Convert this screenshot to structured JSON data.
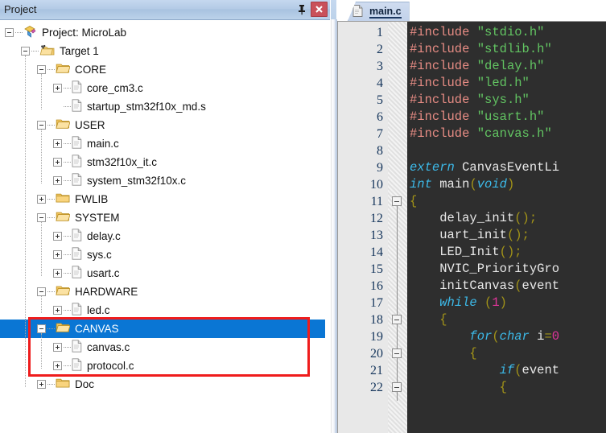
{
  "project_panel": {
    "title": "Project",
    "pin_icon": "pin-icon",
    "close_icon": "close-icon",
    "tree": [
      {
        "label": "Project: MicroLab",
        "depth": 0,
        "icon": "project-icon",
        "expander": "minus",
        "selected": false
      },
      {
        "label": "Target 1",
        "depth": 1,
        "icon": "target-folder-icon",
        "expander": "minus",
        "selected": false
      },
      {
        "label": "CORE",
        "depth": 2,
        "icon": "folder-open-icon",
        "expander": "minus",
        "selected": false
      },
      {
        "label": "core_cm3.c",
        "depth": 3,
        "icon": "c-file-icon",
        "expander": "plus",
        "selected": false
      },
      {
        "label": "startup_stm32f10x_md.s",
        "depth": 3,
        "icon": "s-file-icon",
        "expander": "none",
        "selected": false
      },
      {
        "label": "USER",
        "depth": 2,
        "icon": "folder-open-icon",
        "expander": "minus",
        "selected": false
      },
      {
        "label": "main.c",
        "depth": 3,
        "icon": "c-file-icon",
        "expander": "plus",
        "selected": false
      },
      {
        "label": "stm32f10x_it.c",
        "depth": 3,
        "icon": "c-file-icon",
        "expander": "plus",
        "selected": false
      },
      {
        "label": "system_stm32f10x.c",
        "depth": 3,
        "icon": "c-file-icon",
        "expander": "plus",
        "selected": false
      },
      {
        "label": "FWLIB",
        "depth": 2,
        "icon": "folder-closed-icon",
        "expander": "plus",
        "selected": false
      },
      {
        "label": "SYSTEM",
        "depth": 2,
        "icon": "folder-open-icon",
        "expander": "minus",
        "selected": false
      },
      {
        "label": "delay.c",
        "depth": 3,
        "icon": "c-file-icon",
        "expander": "plus",
        "selected": false
      },
      {
        "label": "sys.c",
        "depth": 3,
        "icon": "c-file-icon",
        "expander": "plus",
        "selected": false
      },
      {
        "label": "usart.c",
        "depth": 3,
        "icon": "c-file-icon",
        "expander": "plus",
        "selected": false
      },
      {
        "label": "HARDWARE",
        "depth": 2,
        "icon": "folder-open-icon",
        "expander": "minus",
        "selected": false
      },
      {
        "label": "led.c",
        "depth": 3,
        "icon": "c-file-icon",
        "expander": "plus",
        "selected": false
      },
      {
        "label": "CANVAS",
        "depth": 2,
        "icon": "folder-open-icon",
        "expander": "minus",
        "selected": true
      },
      {
        "label": "canvas.c",
        "depth": 3,
        "icon": "c-file-icon",
        "expander": "plus",
        "selected": false
      },
      {
        "label": "protocol.c",
        "depth": 3,
        "icon": "c-file-icon",
        "expander": "plus",
        "selected": false
      },
      {
        "label": "Doc",
        "depth": 2,
        "icon": "folder-closed-icon",
        "expander": "plus",
        "selected": false
      }
    ]
  },
  "annotation": {
    "shape": "rectangle",
    "color": "#ef1c1c",
    "covers": [
      "CANVAS",
      "canvas.c",
      "protocol.c"
    ]
  },
  "editor": {
    "tabs": [
      {
        "label": "main.c",
        "icon": "c-file-icon",
        "active": true
      }
    ],
    "selection_color": "#0a76d4",
    "background": "#2e2e2e",
    "gutter_background": "#e8e8e8",
    "line_number_color": "#16365c",
    "first_visible_line": 1,
    "last_visible_line": 22,
    "lines": [
      {
        "n": 1,
        "fold": false,
        "text": "#include \"stdio.h\""
      },
      {
        "n": 2,
        "fold": false,
        "text": "#include \"stdlib.h\""
      },
      {
        "n": 3,
        "fold": false,
        "text": "#include \"delay.h\""
      },
      {
        "n": 4,
        "fold": false,
        "text": "#include \"led.h\""
      },
      {
        "n": 5,
        "fold": false,
        "text": "#include \"sys.h\""
      },
      {
        "n": 6,
        "fold": false,
        "text": "#include \"usart.h\""
      },
      {
        "n": 7,
        "fold": false,
        "text": "#include \"canvas.h\""
      },
      {
        "n": 8,
        "fold": false,
        "text": ""
      },
      {
        "n": 9,
        "fold": false,
        "text": "extern CanvasEventLi"
      },
      {
        "n": 10,
        "fold": false,
        "text": "int main(void)"
      },
      {
        "n": 11,
        "fold": true,
        "text": "{"
      },
      {
        "n": 12,
        "fold": false,
        "text": "    delay_init();"
      },
      {
        "n": 13,
        "fold": false,
        "text": "    uart_init();"
      },
      {
        "n": 14,
        "fold": false,
        "text": "    LED_Init();"
      },
      {
        "n": 15,
        "fold": false,
        "text": "    NVIC_PriorityGro"
      },
      {
        "n": 16,
        "fold": false,
        "text": "    initCanvas(event"
      },
      {
        "n": 17,
        "fold": false,
        "text": "    while (1)"
      },
      {
        "n": 18,
        "fold": true,
        "text": "    {"
      },
      {
        "n": 19,
        "fold": false,
        "text": "        for(char i=0"
      },
      {
        "n": 20,
        "fold": true,
        "text": "        {"
      },
      {
        "n": 21,
        "fold": false,
        "text": "            if(event"
      },
      {
        "n": 22,
        "fold": true,
        "text": "            {"
      }
    ]
  }
}
